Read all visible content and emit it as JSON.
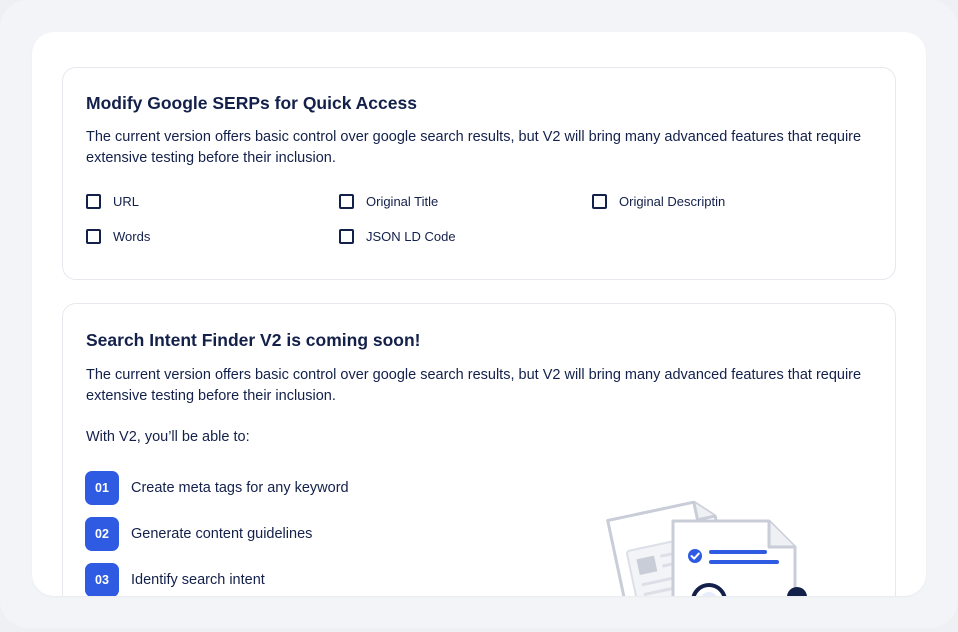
{
  "serp_card": {
    "title": "Modify Google SERPs for Quick Access",
    "description": "The current version offers basic control over google search results, but V2 will bring many advanced features that require extensive testing before their inclusion.",
    "options": [
      {
        "label": "URL",
        "checked": false
      },
      {
        "label": "Original Title",
        "checked": false
      },
      {
        "label": "Original Descriptin",
        "checked": false
      },
      {
        "label": "Words",
        "checked": false
      },
      {
        "label": "JSON LD Code",
        "checked": false
      }
    ]
  },
  "intent_card": {
    "title": "Search Intent Finder V2 is coming soon!",
    "description": "The current version offers basic control over google search results, but V2 will bring many advanced features that require extensive testing before their inclusion.",
    "intro": "With V2, you’ll be able to:",
    "features": [
      {
        "number": "01",
        "text": "Create meta tags for any keyword"
      },
      {
        "number": "02",
        "text": "Generate content guidelines"
      },
      {
        "number": "03",
        "text": "Identify search intent"
      }
    ]
  },
  "colors": {
    "accent": "#2f5be3",
    "text": "#13204a",
    "border": "#e6e8ee",
    "background": "#f3f4f7"
  },
  "icons": {
    "illustration": "documents-checklist-illustration"
  }
}
